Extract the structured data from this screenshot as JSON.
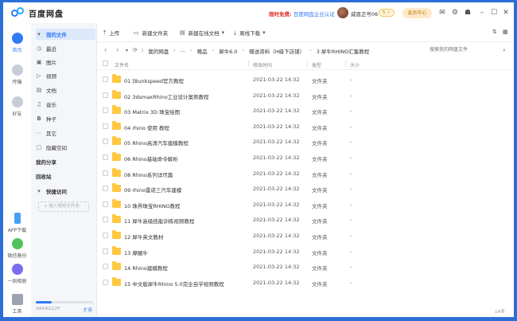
{
  "app": {
    "name": "百度网盘"
  },
  "titlebar": {
    "promo_prefix": "限时免费:",
    "promo_text": "百度网盘企业认证",
    "username": "威恩正号06",
    "vip_badge": "5 ☆",
    "member_button": "会员中心"
  },
  "rail": {
    "items": [
      {
        "label": "首页",
        "icon": "home-icon"
      },
      {
        "label": "传输",
        "icon": "transfer-icon"
      },
      {
        "label": "好友",
        "icon": "friends-icon"
      },
      {
        "label": "APP下载",
        "icon": "phone-icon"
      },
      {
        "label": "微信备份",
        "icon": "wechat-icon"
      },
      {
        "label": "一刻相册",
        "icon": "album-icon"
      },
      {
        "label": "工具",
        "icon": "tools-icon"
      }
    ]
  },
  "nav": {
    "my_files": "我的文件",
    "items": [
      {
        "label": "最近",
        "icon": "clock-icon"
      },
      {
        "label": "图片",
        "icon": "image-icon"
      },
      {
        "label": "视频",
        "icon": "video-icon"
      },
      {
        "label": "文档",
        "icon": "doc-icon"
      },
      {
        "label": "音乐",
        "icon": "music-icon"
      },
      {
        "label": "种子",
        "icon": "bt-icon"
      },
      {
        "label": "其它",
        "icon": "more-icon"
      },
      {
        "label": "隐藏空间",
        "icon": "lock-icon"
      }
    ],
    "my_share": "我的分享",
    "recycle": "回收站",
    "quick_access": "快捷访问",
    "add_folder": "+ 拖入常用文件夹",
    "storage_text": "3443G/12T",
    "storage_fraction": 0.28,
    "expand": "扩容"
  },
  "toolbar": {
    "upload": "上传",
    "new_folder": "新建文件夹",
    "new_online_doc": "新建在线文档",
    "offline_download": "离线下载"
  },
  "breadcrumb": [
    "我的网盘",
    "...",
    "赠品",
    "犀牛6.0",
    "赠送资料（H级下店铺）",
    "3 犀牛RHINO汇集教程"
  ],
  "search_placeholder": "搜索我的网盘文件",
  "table": {
    "headers": {
      "name": "文件名",
      "time": "修改时间",
      "type": "类型",
      "size": "大小"
    },
    "rows": [
      {
        "name": "01 [Bunkspeed官方教程",
        "time": "2021-03-22 14:32",
        "type": "文件夹",
        "size": "-"
      },
      {
        "name": "02 3dsmaxRhino工业设计案例教程",
        "time": "2021-03-22 14:32",
        "type": "文件夹",
        "size": "-"
      },
      {
        "name": "03 Matrix 3D 珠宝绘图",
        "time": "2021-03-22 14:32",
        "type": "文件夹",
        "size": "-"
      },
      {
        "name": "04 rhino 使用 教程",
        "time": "2021-03-22 14:32",
        "type": "文件夹",
        "size": "-"
      },
      {
        "name": "05 Rhino高清汽车建模教程",
        "time": "2021-03-22 14:32",
        "type": "文件夹",
        "size": "-"
      },
      {
        "name": "06 Rhino基础命令解析",
        "time": "2021-03-22 14:32",
        "type": "文件夹",
        "size": "-"
      },
      {
        "name": "08 Rhino系列详尽篇",
        "time": "2021-03-22 14:32",
        "type": "文件夹",
        "size": "-"
      },
      {
        "name": "09 rhino雷诺三汽车建模",
        "time": "2021-03-22 14:32",
        "type": "文件夹",
        "size": "-"
      },
      {
        "name": "10 珠界珠宝RHINO教程",
        "time": "2021-03-22 14:32",
        "type": "文件夹",
        "size": "-"
      },
      {
        "name": "11 犀牛高级技能训练视频教程",
        "time": "2021-03-22 14:32",
        "type": "文件夹",
        "size": "-"
      },
      {
        "name": "12 犀牛英文教材",
        "time": "2021-03-22 14:32",
        "type": "文件夹",
        "size": "-"
      },
      {
        "name": "13 摩圈牛",
        "time": "2021-03-22 14:32",
        "type": "文件夹",
        "size": "-"
      },
      {
        "name": "14 Rhino建模教程",
        "time": "2021-03-22 14:32",
        "type": "文件夹",
        "size": "-"
      },
      {
        "name": "15 中文版犀牛Rhino 5.0完全自学视频教程",
        "time": "2021-03-22 14:32",
        "type": "文件夹",
        "size": "-"
      }
    ]
  },
  "item_count": "14项",
  "colors": {
    "accent": "#2f7cf6",
    "folder": "#ffc840",
    "promo": "#e0302b"
  }
}
